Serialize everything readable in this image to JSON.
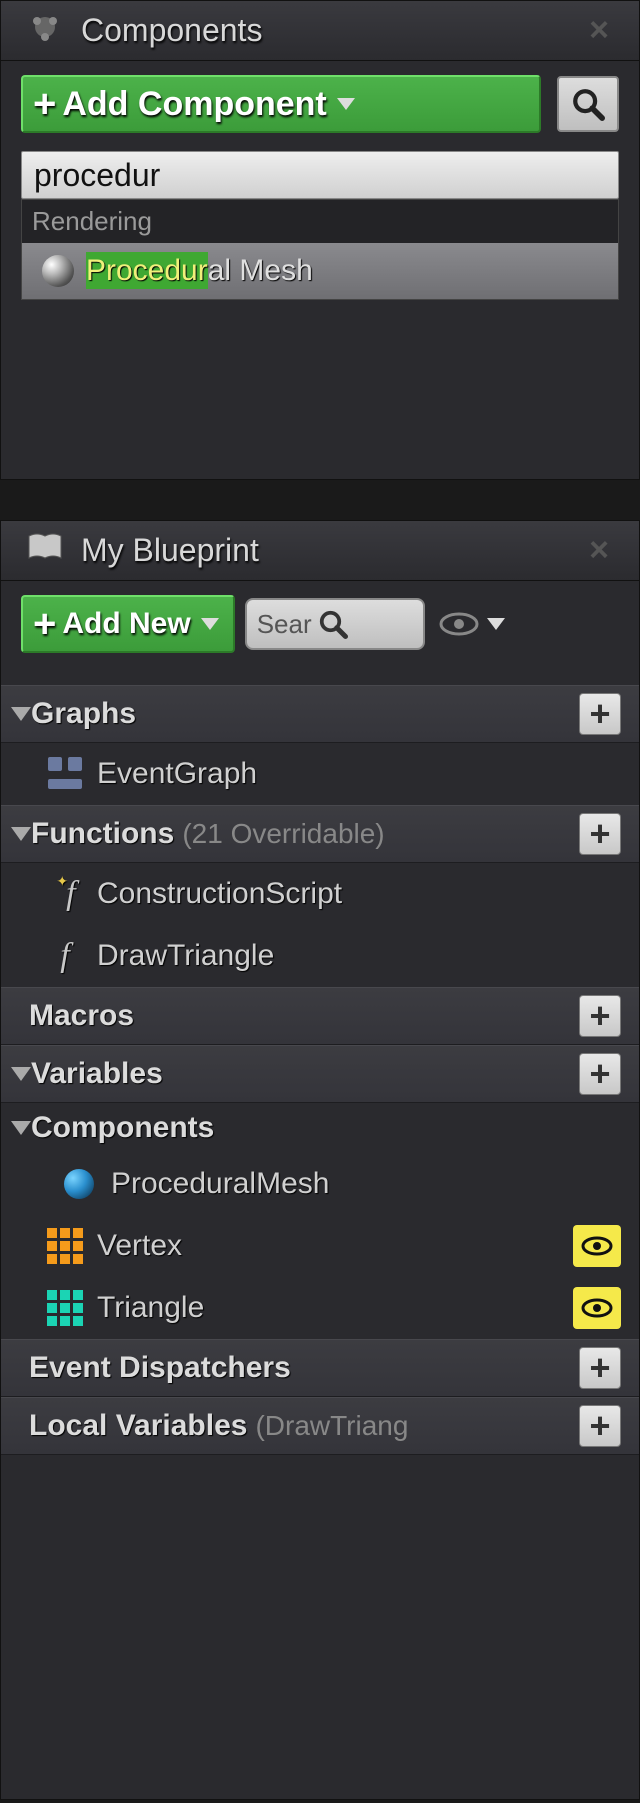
{
  "components_panel": {
    "title": "Components",
    "add_button": "Add Component",
    "search_value": "procedur",
    "result_category": "Rendering",
    "result_item_prefix": "Procedur",
    "result_item_suffix": "al Mesh"
  },
  "blueprint_panel": {
    "title": "My Blueprint",
    "add_button": "Add New",
    "search_placeholder": "Sear",
    "sections": {
      "graphs": {
        "label": "Graphs",
        "items": [
          "EventGraph"
        ]
      },
      "functions": {
        "label": "Functions",
        "note": "(21 Overridable)",
        "items": [
          "ConstructionScript",
          "DrawTriangle"
        ]
      },
      "macros": {
        "label": "Macros"
      },
      "variables": {
        "label": "Variables"
      },
      "components": {
        "label": "Components",
        "items": [
          "ProceduralMesh",
          "Vertex",
          "Triangle"
        ]
      },
      "event_dispatchers": {
        "label": "Event Dispatchers"
      },
      "local_variables": {
        "label": "Local Variables",
        "note": "(DrawTriang"
      }
    }
  }
}
